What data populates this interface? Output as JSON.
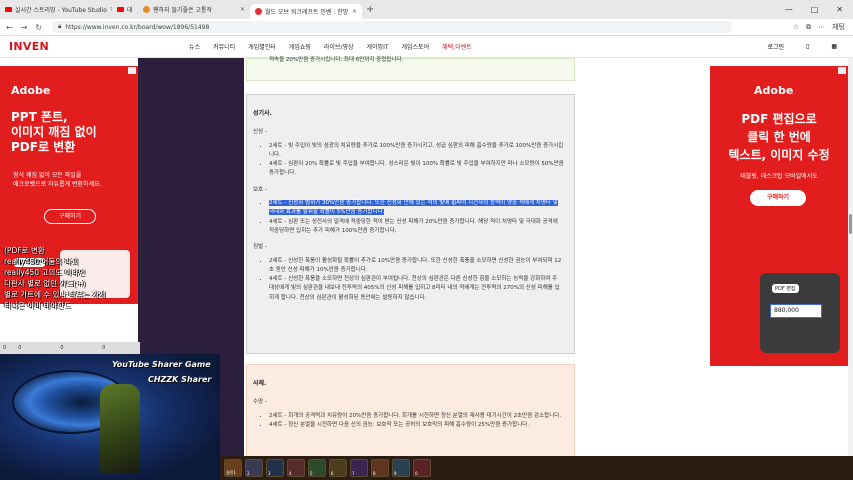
{
  "browser": {
    "tabs": [
      {
        "label": "실시간 스트리밍 - YouTube Studio",
        "icon": "youtube-icon"
      },
      {
        "label": "대",
        "icon": "youtube-icon"
      },
      {
        "label": "팬하지 들기좋은 고통작",
        "icon": "site-icon"
      },
      {
        "label": "월드 오브 워크래프트 인벤 : 한밤",
        "icon": "inven-icon"
      }
    ],
    "new_tab": "+",
    "url": "https://www.inven.co.kr/board/wow/1896/51498",
    "controls": [
      "—",
      "□",
      "✕"
    ],
    "profile_label": "채팅"
  },
  "site": {
    "logo": "INVEN",
    "menu": [
      "뉴스",
      "커뮤니티",
      "게임별인터",
      "게임쇼핑",
      "라이브/영상",
      "게이밍IT",
      "게임스토어",
      "혜택,이벤트"
    ],
    "login": "로그인"
  },
  "ad_left": {
    "brand": "Adobe",
    "headline_1": "PPT 폰트,",
    "headline_2": "이미지 깨짐 없이",
    "headline_3": "PDF로 변환",
    "sub_1": "형식 깨짐 없이 모든 파일을",
    "sub_2": "애크로뱃으로 자유롭게 변환하세요.",
    "button": "구매하기",
    "chip": "PDF로 변환"
  },
  "ad_right": {
    "brand": "Adobe",
    "headline_1": "PDF 편집으로",
    "headline_2": "클릭 한 번에",
    "headline_3": "텍스트, 이미지 수정",
    "sub": "태블릿, 데스크탑 모바일에서도",
    "button": "구매하기",
    "chip": "PDF 편집",
    "price": "880,000"
  },
  "article": {
    "top_line": "적속을 20%만큼 증가시킵니다. 최대 6만까지 중첩됩니다.",
    "box1_title": "성기사.",
    "sections": [
      {
        "heading": "신성 -",
        "items": [
          "2세트 - 빛 주입이 빛의 섬광의 치유량을 추가로 100%만큼 증가시키고, 성급 심판의 피해 흡수량을 추가로 100%만큼 증가시킵니다.",
          "4세트 - 심판이 20% 확률로 빛 주입을 부여합니다. 성스러운 빛이 100% 확률로 빛 주입을 부여하지만 마나 소모량이 50%만큼 증가합니다."
        ]
      },
      {
        "heading": "보호 -",
        "items": [
          "2세트 - 신성화 범위가 30%만큼 증가합니다. 또한 신성화 안에 있는 적의 빛에 휩싸여 시전자의 능력이 명중 적에게 치명타 및 극대화 효과를 발휘할 확률이 5%만큼 증가합니다.",
          "4세트 - 심판 또는 성전사의 일격에 적중당한 적이 받는 신성 피해가 20%만큼 증가합니다. 해당 적이 치명타 및 극대화 공격에 적중당하면 입히는 추가 피해가 100%만큼 증가합니다."
        ]
      },
      {
        "heading": "징벌 -",
        "items": [
          "2세트 - 신성한 폭풍이 활성화될 확률이 추가로 10%만큼 증가합니다. 또한 신성한 폭풍을 소모하면 신성한 권능이 부여되며 12초 동안 신성 피해가 10%만큼 증가합니다.",
          "4세트 - 신성한 폭풍을 소모하면 천상의 심판관이 부여됩니다. 천상의 심판관은 다른 신성한 힘을 소모하는 능력을 강화하여 주 대상에게 빛의 심판관을 내보내 전투력의 405%의 신성 피해를 입히고 8미터 내의 적에게는 전투력의 270%의 신성 피해를 입히게 합니다. 천상의 심판관이 활성화된 동안에는 발동하지 않습니다."
        ]
      }
    ],
    "box2_title": "사제.",
    "sections2": [
      {
        "heading": "수양 -",
        "items": [
          "2세트 - 회개의 공격력과 치유량이 20%만큼 증가합니다. 회개를 시전하면 정신 분열의 재사용 대기시간이 2초만큼 감소합니다.",
          "4세트 - 정신 분열을 시전하면 다음 신의 권능: 보호막 또는 공허의 보호막의 피해 흡수량이 25%만큼 증가합니다."
        ]
      }
    ]
  },
  "stream": {
    "chat": [
      "(PDF로 변환",
      "really450 어둠의 파괴",
      "really450 고의도 이라면",
      "다판사 별로 없던 가드(+)",
      "별로 가트에 수 있나 타우는 가게",
      "티나온 이미 테어한드"
    ],
    "overlay_1": "YouTube Sharer Game",
    "overlay_2": "CHZZK Sharer",
    "bar_counts": [
      "0",
      "0",
      "0",
      "0"
    ],
    "hotbar_labels": [
      "실전1",
      "2",
      "3",
      "4",
      "5",
      "6",
      "7",
      "8",
      "9",
      "0"
    ]
  },
  "colors": {
    "brand_red": "#d2161e",
    "ad_red": "#e11d1d",
    "selection": "#2f62d4",
    "box_gray": "#efefef",
    "box_peach": "#fcebe0"
  }
}
